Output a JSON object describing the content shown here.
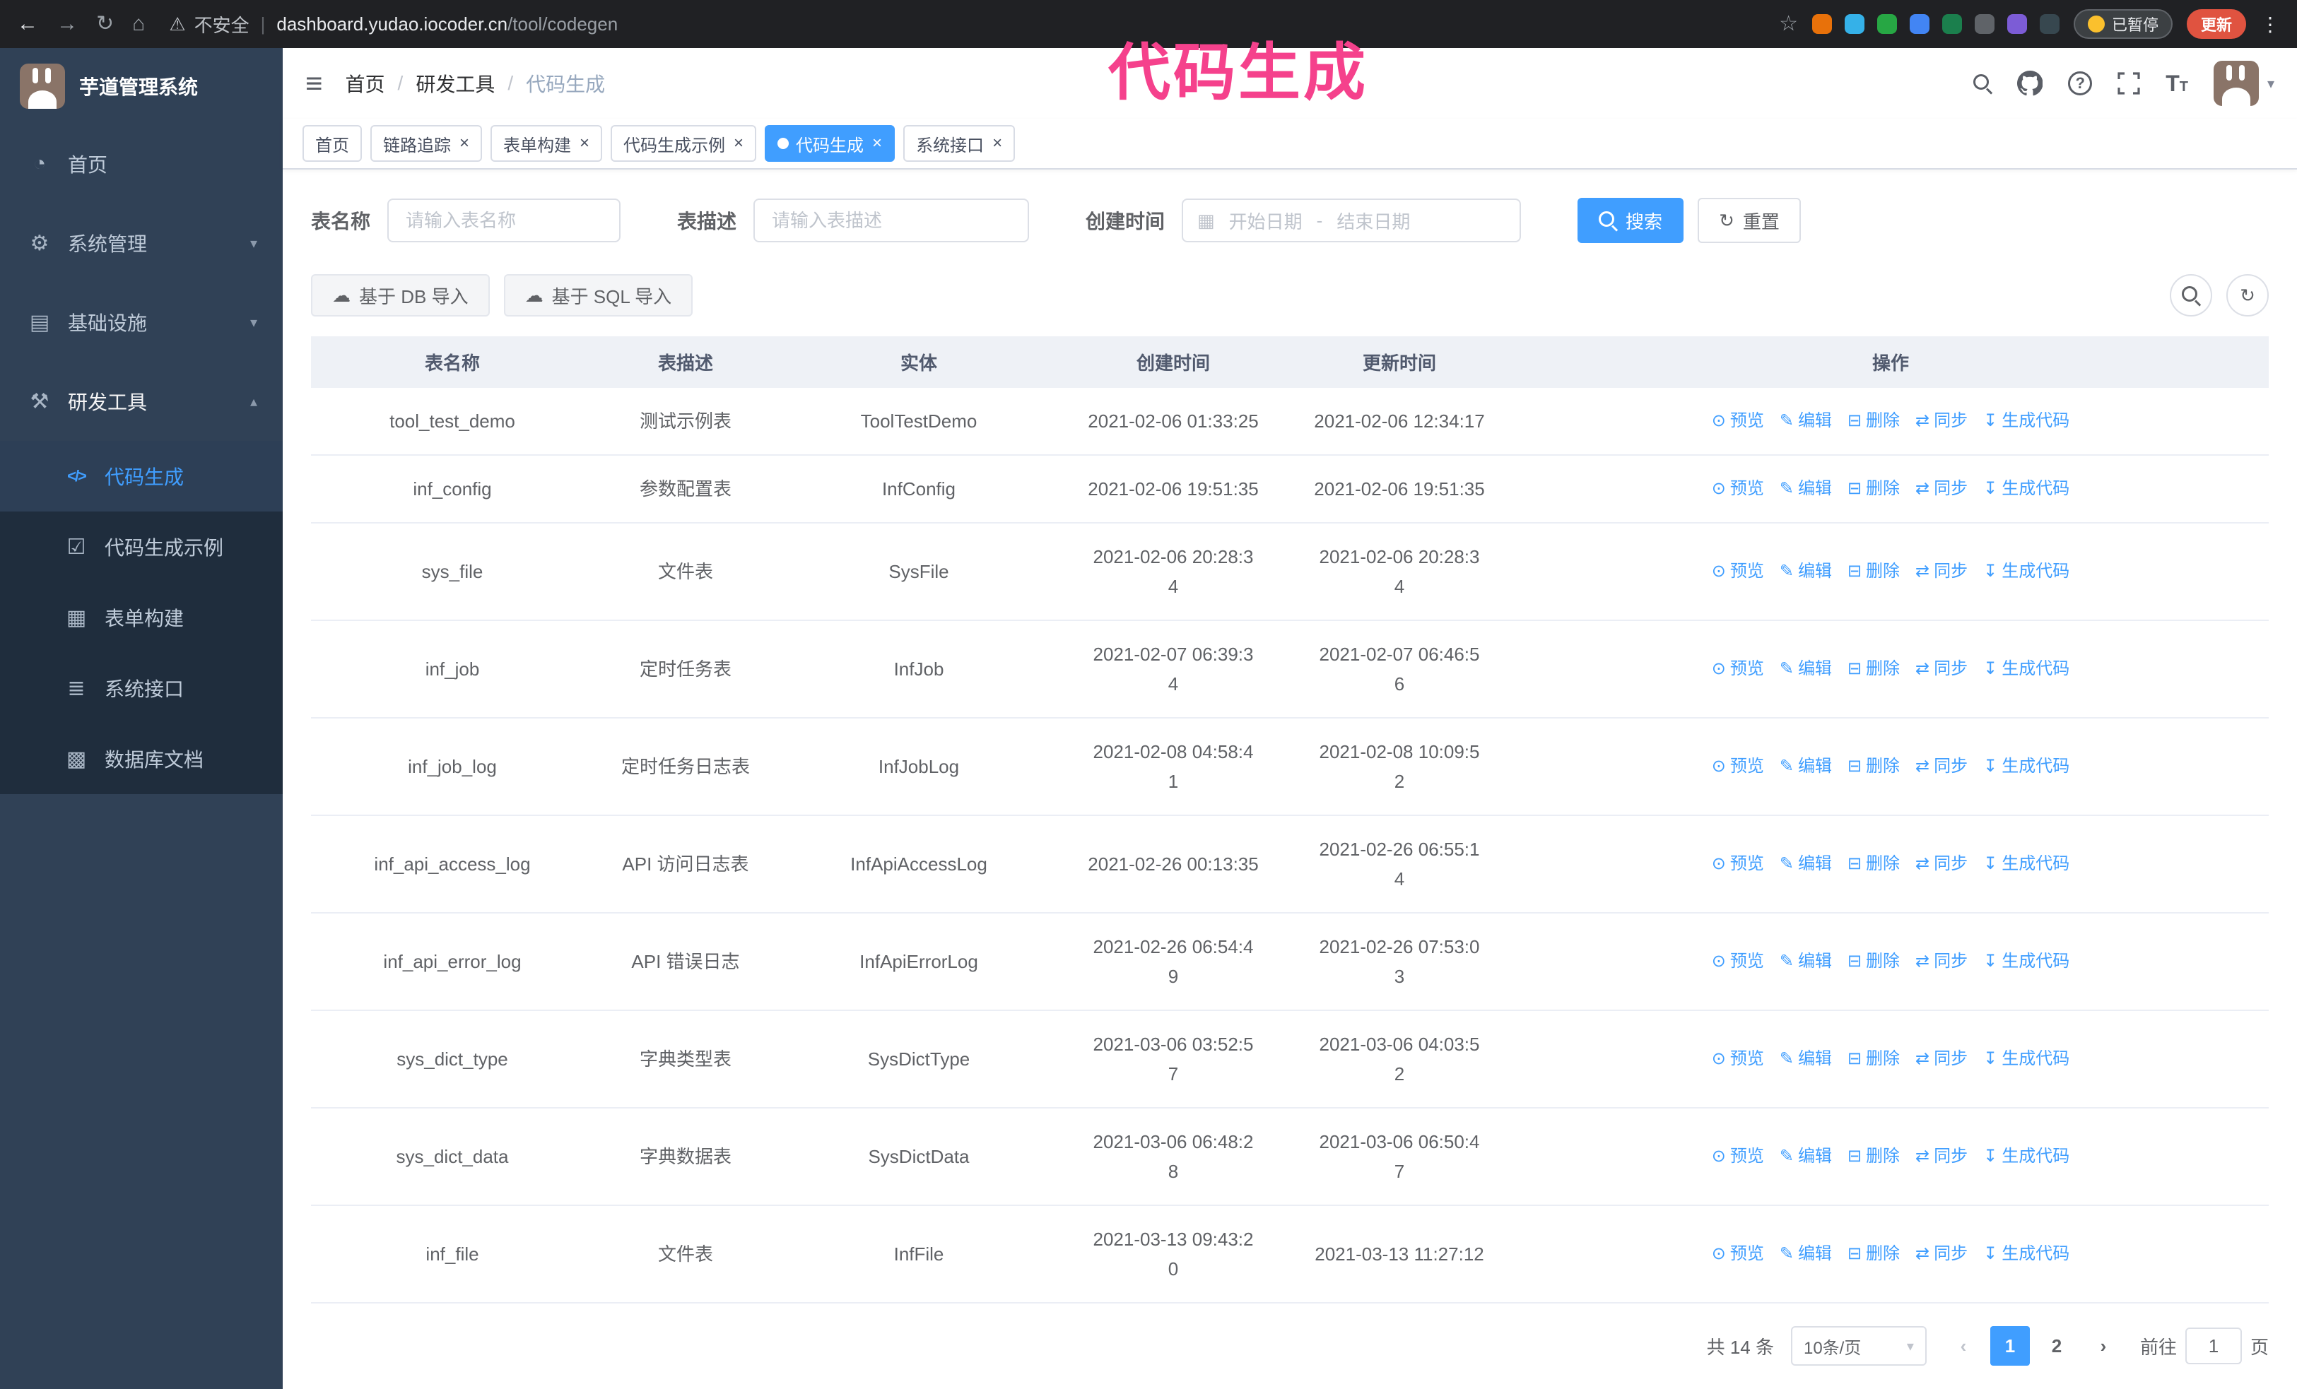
{
  "colors": {
    "accent": "#409eff",
    "overlay": "#f5418c",
    "sidebar": "#304156",
    "submenu": "#1f2d3d",
    "submenuActive": "#2d3f56",
    "chrome": "#202124"
  },
  "overlay_text": "代码生成",
  "browser": {
    "security_label": "不安全",
    "url_host": "dashboard.yudao.iocoder.cn",
    "url_path": "/tool/codegen",
    "paused_badge": "已暂停",
    "update_label": "更新",
    "extension_colors": [
      "#e8710a",
      "#35b1e8",
      "#27a744",
      "#4285f4",
      "#1b7f4d",
      "#5f6368",
      "#7c5cd6",
      "#37474f"
    ]
  },
  "sidebar": {
    "app_title": "芋道管理系统",
    "items": [
      {
        "label": "首页"
      },
      {
        "label": "系统管理"
      },
      {
        "label": "基础设施"
      },
      {
        "label": "研发工具"
      }
    ],
    "subitems": [
      {
        "label": "代码生成"
      },
      {
        "label": "代码生成示例"
      },
      {
        "label": "表单构建"
      },
      {
        "label": "系统接口"
      },
      {
        "label": "数据库文档"
      }
    ]
  },
  "header": {
    "breadcrumb": [
      "首页",
      "研发工具",
      "代码生成"
    ]
  },
  "tabs": [
    {
      "label": "首页"
    },
    {
      "label": "链路追踪"
    },
    {
      "label": "表单构建"
    },
    {
      "label": "代码生成示例"
    },
    {
      "label": "代码生成"
    },
    {
      "label": "系统接口"
    }
  ],
  "filters": {
    "name_label": "表名称",
    "name_placeholder": "请输入表名称",
    "desc_label": "表描述",
    "desc_placeholder": "请输入表描述",
    "date_label": "创建时间",
    "date_start_placeholder": "开始日期",
    "date_separator": "-",
    "date_end_placeholder": "结束日期",
    "search_label": "搜索",
    "reset_label": "重置"
  },
  "toolbar": {
    "import_db_label": "基于 DB 导入",
    "import_sql_label": "基于 SQL 导入"
  },
  "table": {
    "headers": [
      "表名称",
      "表描述",
      "实体",
      "创建时间",
      "更新时间",
      "操作"
    ],
    "actions": [
      "预览",
      "编辑",
      "删除",
      "同步",
      "生成代码"
    ],
    "rows": [
      {
        "name": "tool_test_demo",
        "desc": "测试示例表",
        "entity": "ToolTestDemo",
        "created": "2021-02-06 01:33:25",
        "updated": "2021-02-06 12:34:17"
      },
      {
        "name": "inf_config",
        "desc": "参数配置表",
        "entity": "InfConfig",
        "created": "2021-02-06 19:51:35",
        "updated": "2021-02-06 19:51:35"
      },
      {
        "name": "sys_file",
        "desc": "文件表",
        "entity": "SysFile",
        "created": "2021-02-06 20:28:3\n4",
        "updated": "2021-02-06 20:28:3\n4"
      },
      {
        "name": "inf_job",
        "desc": "定时任务表",
        "entity": "InfJob",
        "created": "2021-02-07 06:39:3\n4",
        "updated": "2021-02-07 06:46:5\n6"
      },
      {
        "name": "inf_job_log",
        "desc": "定时任务日志表",
        "entity": "InfJobLog",
        "created": "2021-02-08 04:58:4\n1",
        "updated": "2021-02-08 10:09:5\n2"
      },
      {
        "name": "inf_api_access_log",
        "desc": "API 访问日志表",
        "entity": "InfApiAccessLog",
        "created": "2021-02-26 00:13:35",
        "updated": "2021-02-26 06:55:1\n4"
      },
      {
        "name": "inf_api_error_log",
        "desc": "API 错误日志",
        "entity": "InfApiErrorLog",
        "created": "2021-02-26 06:54:4\n9",
        "updated": "2021-02-26 07:53:0\n3"
      },
      {
        "name": "sys_dict_type",
        "desc": "字典类型表",
        "entity": "SysDictType",
        "created": "2021-03-06 03:52:5\n7",
        "updated": "2021-03-06 04:03:5\n2"
      },
      {
        "name": "sys_dict_data",
        "desc": "字典数据表",
        "entity": "SysDictData",
        "created": "2021-03-06 06:48:2\n8",
        "updated": "2021-03-06 06:50:4\n7"
      },
      {
        "name": "inf_file",
        "desc": "文件表",
        "entity": "InfFile",
        "created": "2021-03-13 09:43:2\n0",
        "updated": "2021-03-13 11:27:12"
      }
    ]
  },
  "pagination": {
    "total": "共 14 条",
    "page_size": "10条/页",
    "pages": [
      "1",
      "2"
    ],
    "goto_label": "前往",
    "goto_value": "1",
    "page_unit": "页"
  }
}
